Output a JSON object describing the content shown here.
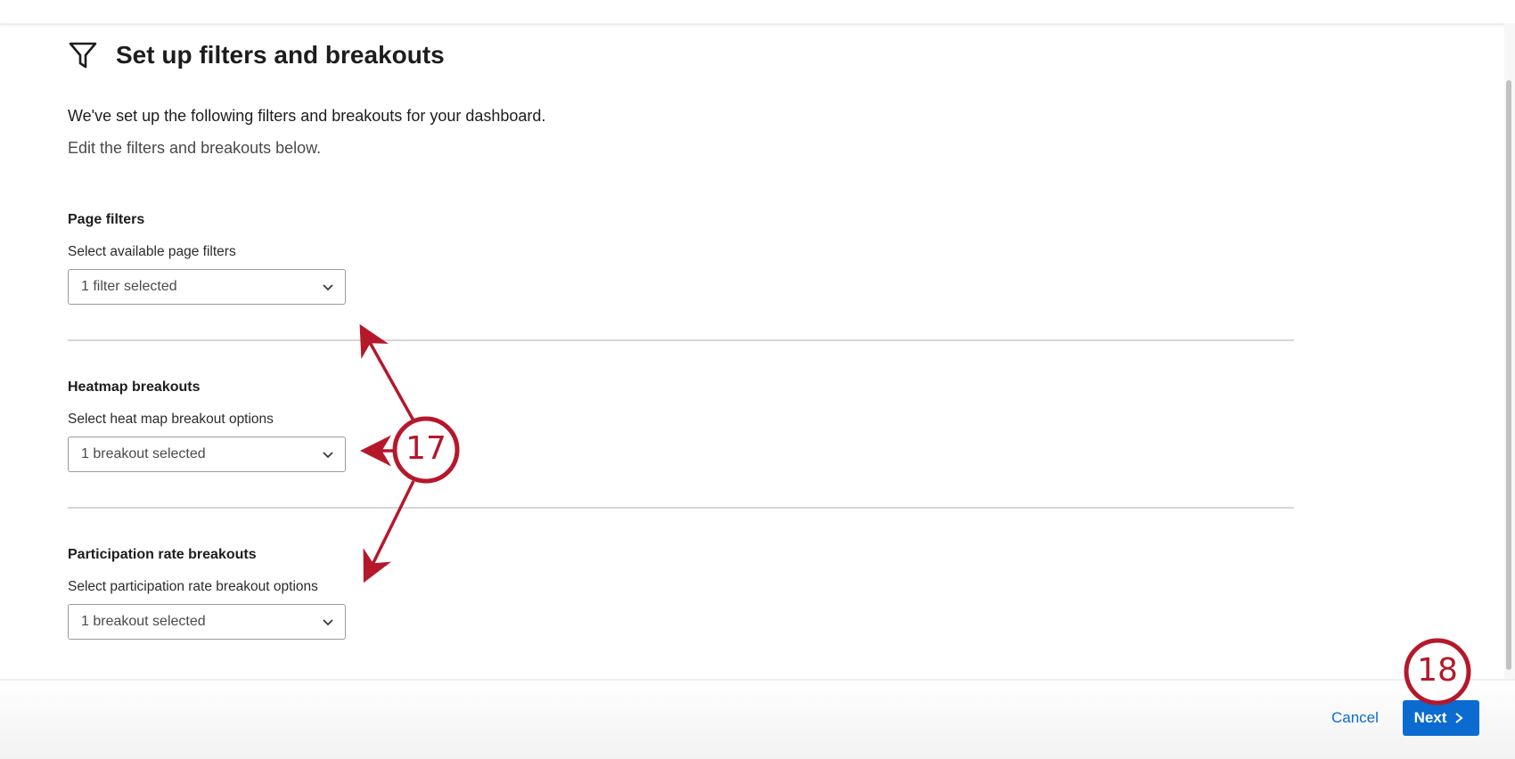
{
  "header": {
    "title": "Set up filters and breakouts",
    "icon": "filter-icon"
  },
  "intro": {
    "line1": "We've set up the following filters and breakouts for your dashboard.",
    "line2": "Edit the filters and breakouts below."
  },
  "sections": [
    {
      "title": "Page filters",
      "subtitle": "Select available page filters",
      "value": "1 filter selected"
    },
    {
      "title": "Heatmap breakouts",
      "subtitle": "Select heat map breakout options",
      "value": "1 breakout selected"
    },
    {
      "title": "Participation rate breakouts",
      "subtitle": "Select participation rate breakout options",
      "value": "1 breakout selected"
    }
  ],
  "footer": {
    "cancel_label": "Cancel",
    "next_label": "Next"
  },
  "callouts": {
    "step17": "17",
    "step18": "18"
  },
  "colors": {
    "accent": "#0b6bd1",
    "callout": "#b5182b"
  }
}
